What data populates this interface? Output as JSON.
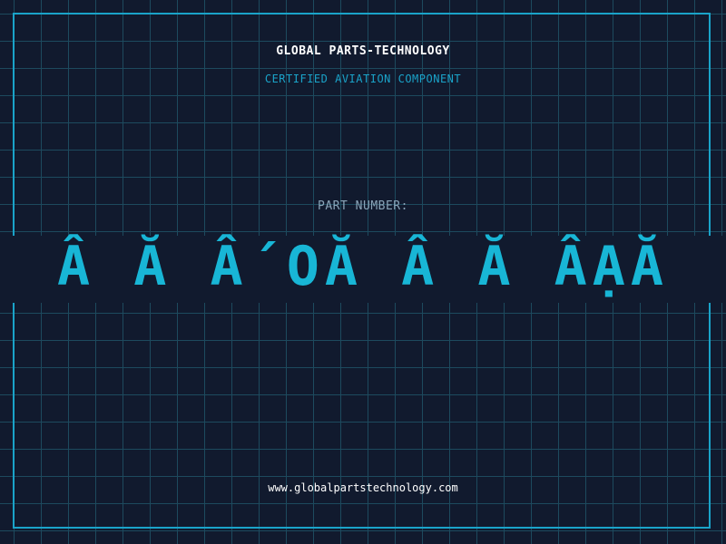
{
  "header": {
    "company": "GLOBAL PARTS-TECHNOLOGY",
    "subtitle": "CERTIFIED AVIATION COMPONENT"
  },
  "part": {
    "label": "PART NUMBER:",
    "number": "Â Ă Â´OĂ Â Ă ÂẠĂ"
  },
  "footer": {
    "website": "www.globalpartstechnology.com"
  },
  "colors": {
    "background": "#111a2e",
    "grid": "#1d4a5e",
    "accent": "#1aa3c9",
    "part_number": "#18b6d6",
    "text": "#ffffff"
  }
}
